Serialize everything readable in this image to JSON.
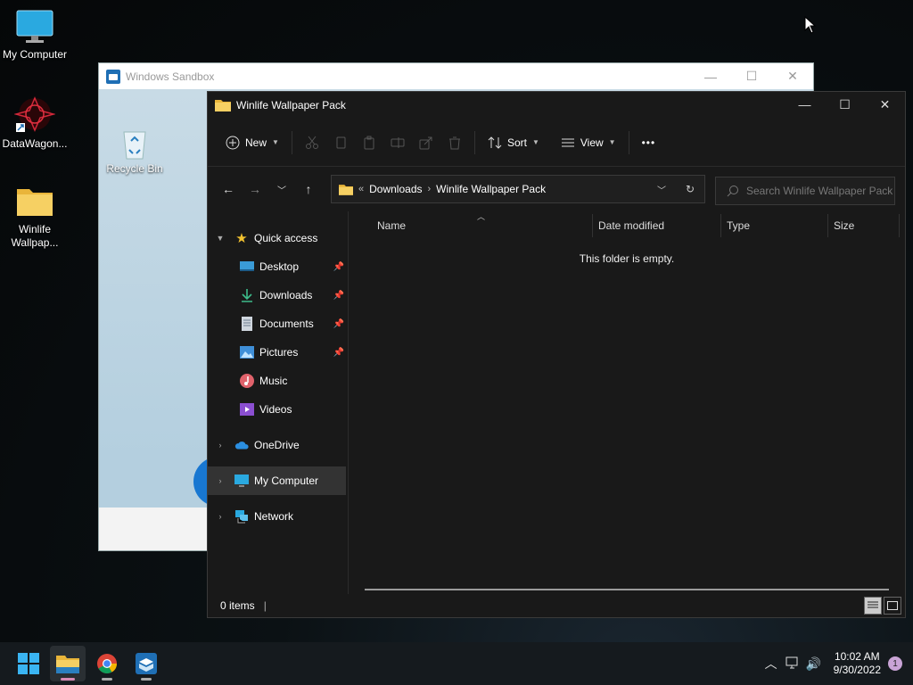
{
  "desktop": {
    "icons": [
      {
        "label": "My Computer",
        "icon": "monitor-icon"
      },
      {
        "label": "DataWagon...",
        "icon": "datawagon-icon"
      },
      {
        "label": "Winlife\nWallpap...",
        "icon": "folder-icon"
      }
    ]
  },
  "sandbox": {
    "title": "Windows Sandbox",
    "recycle_bin_label": "Recycle Bin",
    "controls": [
      "—",
      "☐",
      "✕"
    ]
  },
  "explorer": {
    "title": "Winlife Wallpaper Pack",
    "controls": [
      "—",
      "☐",
      "✕"
    ],
    "toolbar": {
      "new_label": "New",
      "sort_label": "Sort",
      "view_label": "View",
      "more_label": "•••"
    },
    "address": {
      "prefix": "«",
      "crumbs": [
        "Downloads",
        "Winlife Wallpaper Pack"
      ],
      "separator": "›"
    },
    "search": {
      "placeholder": "Search Winlife Wallpaper Pack"
    },
    "nav": {
      "quick_access": "Quick access",
      "quick_items": [
        {
          "label": "Desktop",
          "pinned": true
        },
        {
          "label": "Downloads",
          "pinned": true
        },
        {
          "label": "Documents",
          "pinned": true
        },
        {
          "label": "Pictures",
          "pinned": true
        },
        {
          "label": "Music",
          "pinned": false
        },
        {
          "label": "Videos",
          "pinned": false
        }
      ],
      "onedrive": "OneDrive",
      "my_computer": "My Computer",
      "network": "Network"
    },
    "columns": [
      "Name",
      "Date modified",
      "Type",
      "Size"
    ],
    "empty_message": "This folder is empty.",
    "status": "0 items"
  },
  "taskbar": {
    "time": "10:02 AM",
    "date": "9/30/2022",
    "notification_count": "1"
  },
  "colors": {
    "folder": "#f3c94b",
    "accent": "#1f6fb5",
    "explorer_bg": "#191919"
  }
}
